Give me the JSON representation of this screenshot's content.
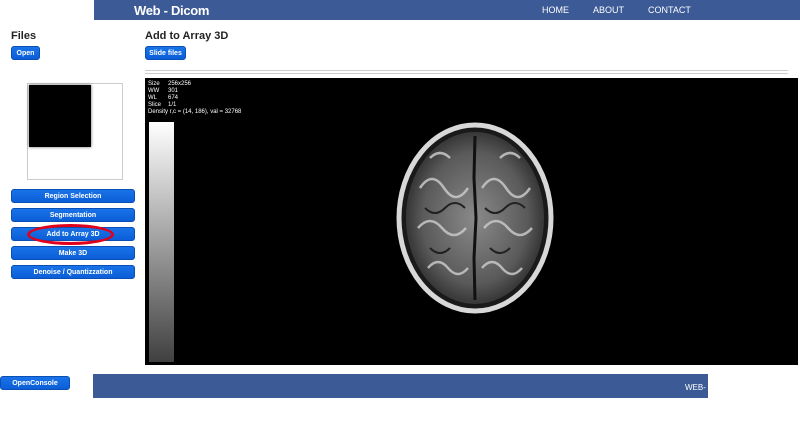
{
  "header": {
    "brand": "Web - Dicom",
    "nav": [
      "HOME",
      "ABOUT",
      "CONTACT"
    ]
  },
  "sidebar": {
    "title": "Files",
    "open_label": "Open",
    "buttons": [
      "Region Selection",
      "Segmentation",
      "Add to Array 3D",
      "Make 3D",
      "Denoise / Quantizzation"
    ]
  },
  "main": {
    "title": "Add to Array 3D",
    "slide_label": "Slide files",
    "overlay": [
      {
        "key": "Size",
        "value": "256x256"
      },
      {
        "key": "WW",
        "value": "301"
      },
      {
        "key": "WL",
        "value": "674"
      },
      {
        "key": "Slice",
        "value": "1/1"
      }
    ],
    "density": "Density r,c = (14, 186), val = 32768"
  },
  "footer": {
    "console_label": "OpenConsole",
    "text": "WEB-"
  },
  "colors": {
    "nav_bg": "#3b5a96",
    "button": "#1a73e8",
    "highlight": "#e0001b"
  }
}
